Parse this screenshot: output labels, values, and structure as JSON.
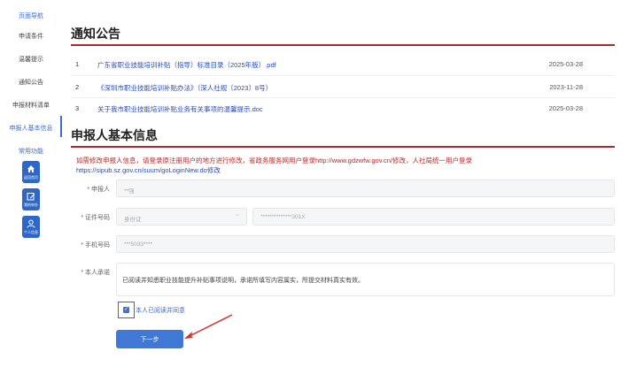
{
  "sidebar": {
    "heading_nav": "页面导航",
    "items": [
      {
        "label": "申请条件",
        "active": false
      },
      {
        "label": "温馨提示",
        "active": false
      },
      {
        "label": "通知公告",
        "active": false
      },
      {
        "label": "申报材料清单",
        "active": false
      },
      {
        "label": "申报人基本信息",
        "active": true
      }
    ],
    "heading_common": "常用功能",
    "tiles": [
      {
        "label": "返回首页",
        "icon": "home-icon"
      },
      {
        "label": "我的申办",
        "icon": "edit-icon"
      },
      {
        "label": "个人信息",
        "icon": "user-icon"
      }
    ],
    "accent_color": "#3b6cc8"
  },
  "notices": {
    "title": "通知公告",
    "rows": [
      {
        "num": "1",
        "name": "广东省职业技能培训补贴（指导）标准目录（2025年版）.pdf",
        "date": "2025-03-28"
      },
      {
        "num": "2",
        "name": "《深圳市职业技能培训补贴办法》（深人社规〔2023〕8号）",
        "date": "2023-11-28"
      },
      {
        "num": "3",
        "name": "关于我市职业技能培训补贴业务有关事项的温馨提示.doc",
        "date": "2025-03-28"
      }
    ],
    "rule_color": "#a82b2b"
  },
  "applicant": {
    "title": "申报人基本信息",
    "hint_line1": "如需修改申报人信息，请登录原注册用户的地方进行修改，省政务服务网用户登录http://www.gdzwfw.gov.cn/修改，人社局统一用户登录",
    "hint_line2": "https://sipub.sz.gov.cn/suum/goLoginNew.do修改",
    "fields": {
      "name_label": "* 申报人",
      "name_value": "**强",
      "id_label": "* 证件号码",
      "id_type_value": "身份证",
      "id_number_value": "**************301X",
      "phone_label": "* 手机号码",
      "phone_value": "***5033****",
      "commit_label": "* 本人承诺",
      "commit_text": "已阅读并知悉职业技能提升补贴事项说明，承诺所填写内容属实，所提交材料真实有效。"
    },
    "agree_label": "本人已阅读并同意",
    "agree_checked": true,
    "next_button": "下一步",
    "highlight_color": "#d6332f"
  }
}
